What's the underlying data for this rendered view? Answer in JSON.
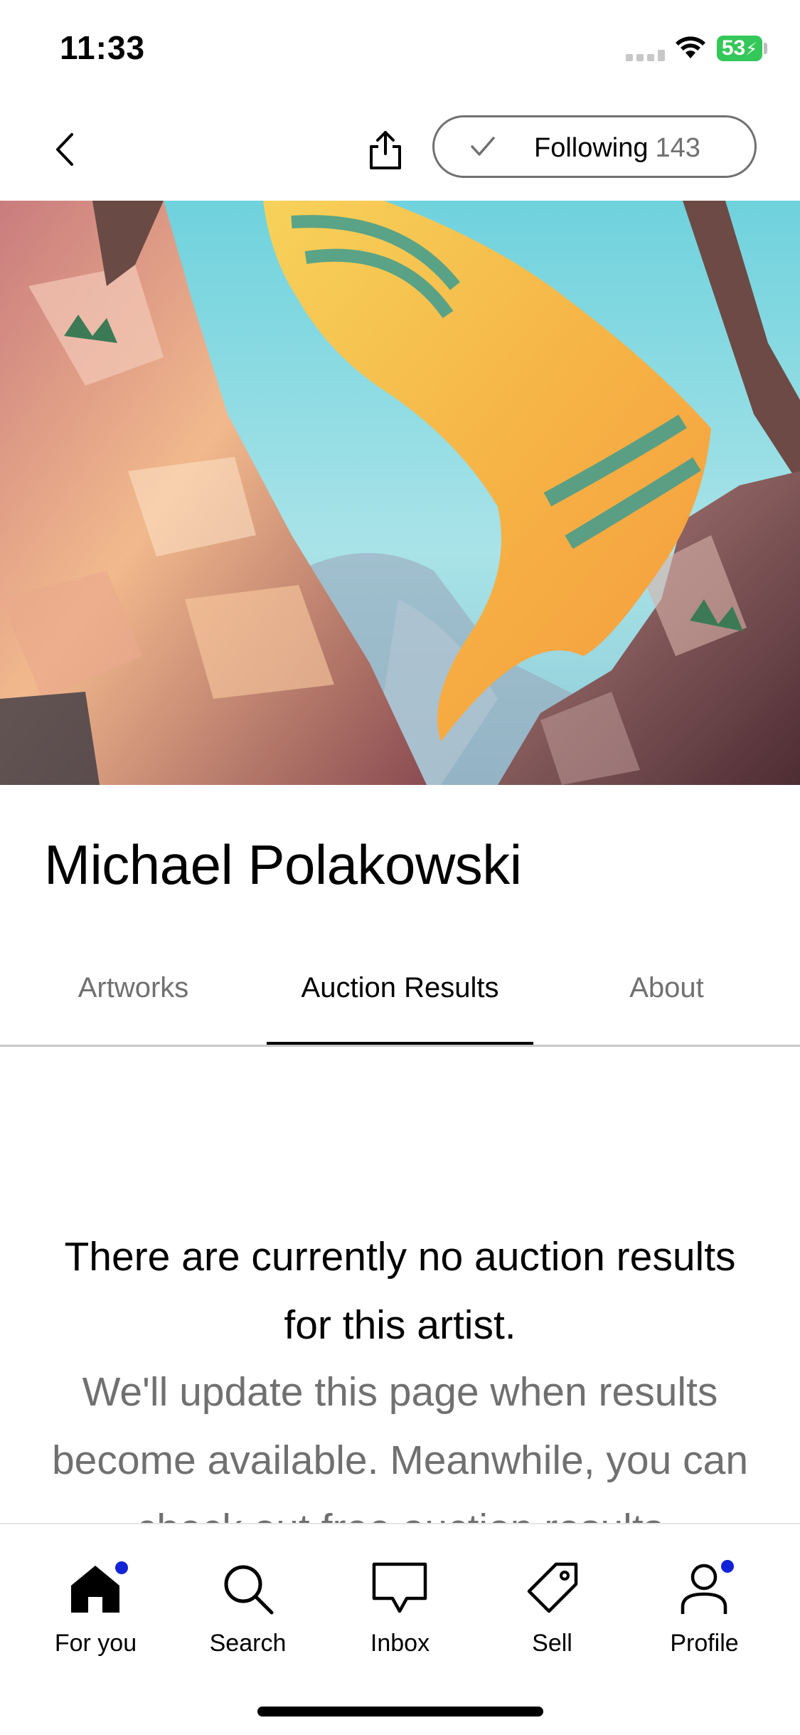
{
  "status_bar": {
    "time": "11:33",
    "battery_level": "53"
  },
  "header": {
    "follow_label": "Following",
    "follow_count": "143"
  },
  "artist": {
    "name": "Michael Polakowski"
  },
  "tabs": [
    {
      "label": "Artworks",
      "active": false
    },
    {
      "label": "Auction Results",
      "active": true
    },
    {
      "label": "About",
      "active": false
    }
  ],
  "empty_state": {
    "title": "There are currently no auction results for this artist.",
    "body": "We'll update this page when results become available. Meanwhile, you can check out free auction results"
  },
  "bottom_nav": {
    "items": [
      {
        "label": "For you",
        "icon": "home-icon",
        "badge": true
      },
      {
        "label": "Search",
        "icon": "search-icon",
        "badge": false
      },
      {
        "label": "Inbox",
        "icon": "inbox-icon",
        "badge": false
      },
      {
        "label": "Sell",
        "icon": "tag-icon",
        "badge": false
      },
      {
        "label": "Profile",
        "icon": "profile-icon",
        "badge": true
      }
    ]
  },
  "colors": {
    "accent_badge": "#1023d7",
    "muted_text": "#707070",
    "battery_green": "#34c759"
  }
}
